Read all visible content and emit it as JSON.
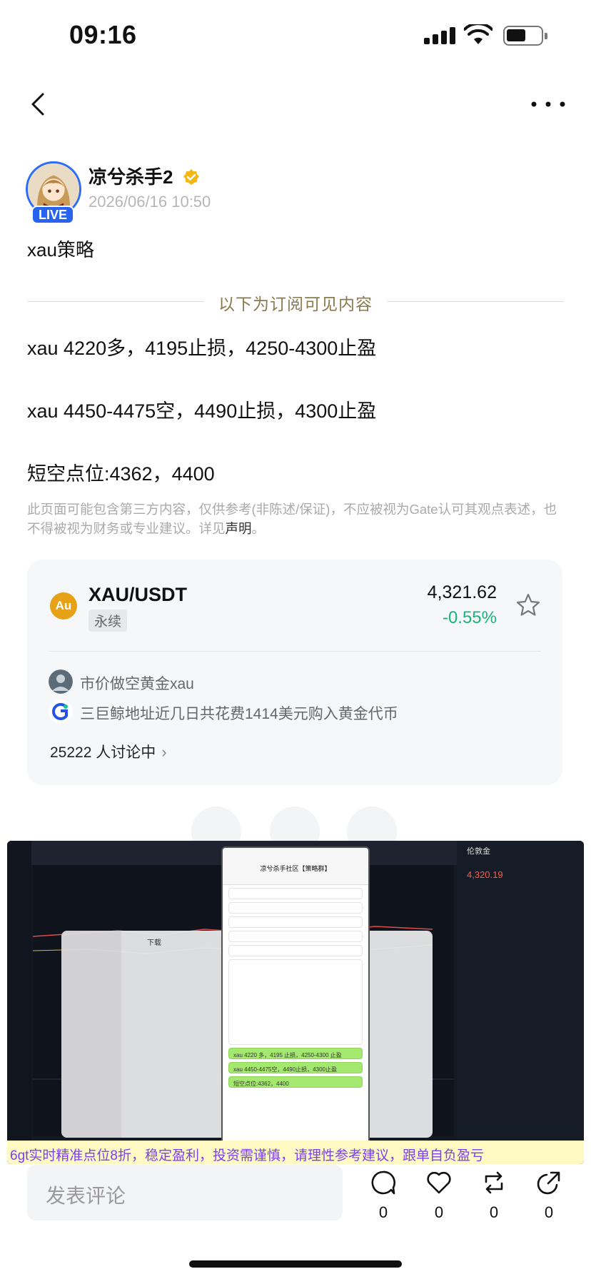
{
  "status_bar": {
    "time": "09:16"
  },
  "author": {
    "name": "凉兮杀手2",
    "live_badge": "LIVE",
    "time": "2026/06/16 10:50"
  },
  "post": {
    "title": "xau策略",
    "subscriber_divider": "以下为订阅可见内容",
    "lines": [
      "xau 4220多，4195止损，4250-4300止盈",
      "xau 4450-4475空，4490止损，4300止盈",
      "短空点位:4362，4400"
    ],
    "disclaimer": "此页面可能包含第三方内容，仅供参考(非陈述/保证)，不应被视为Gate认可其观点表述，也不得被视为财务或专业建议。详见",
    "disclaimer_link": "声明",
    "disclaimer_end": "。"
  },
  "market_card": {
    "coin_icon_text": "Au",
    "pair": "XAU/USDT",
    "tag": "永续",
    "price": "4,321.62",
    "change": "-0.55%",
    "topics": [
      "市价做空黄金xau",
      "三巨鲸地址近几日共花费1414美元购入黄金代币"
    ],
    "discussion": "25222 人讨论中"
  },
  "overlay": {
    "banner": "6gt实时精准点位8折，稳定盈利，投资需谨慎，请理性参考建议，跟单自负盈亏",
    "chat_title": "凉兮杀手社区【策略群】",
    "file_window_title": "下载",
    "right_panel_title": "伦敦金",
    "right_panel_price": "4,320.19",
    "chat_lines": [
      "xau 4220 多，4195 止损，4250-4300 止盈",
      "xau 4450-4475空，4490止损，4300止盈",
      "短空点位:4362，4400"
    ]
  },
  "bottom_bar": {
    "comment_placeholder": "发表评论",
    "comment_count": "0",
    "like_count": "0",
    "repost_count": "0",
    "share_count": "0"
  },
  "colors": {
    "accent_gold": "#8b7a4e",
    "positive_green": "#19b37a",
    "live_blue": "#2762f0",
    "banner_purple": "#7b3ff2"
  }
}
